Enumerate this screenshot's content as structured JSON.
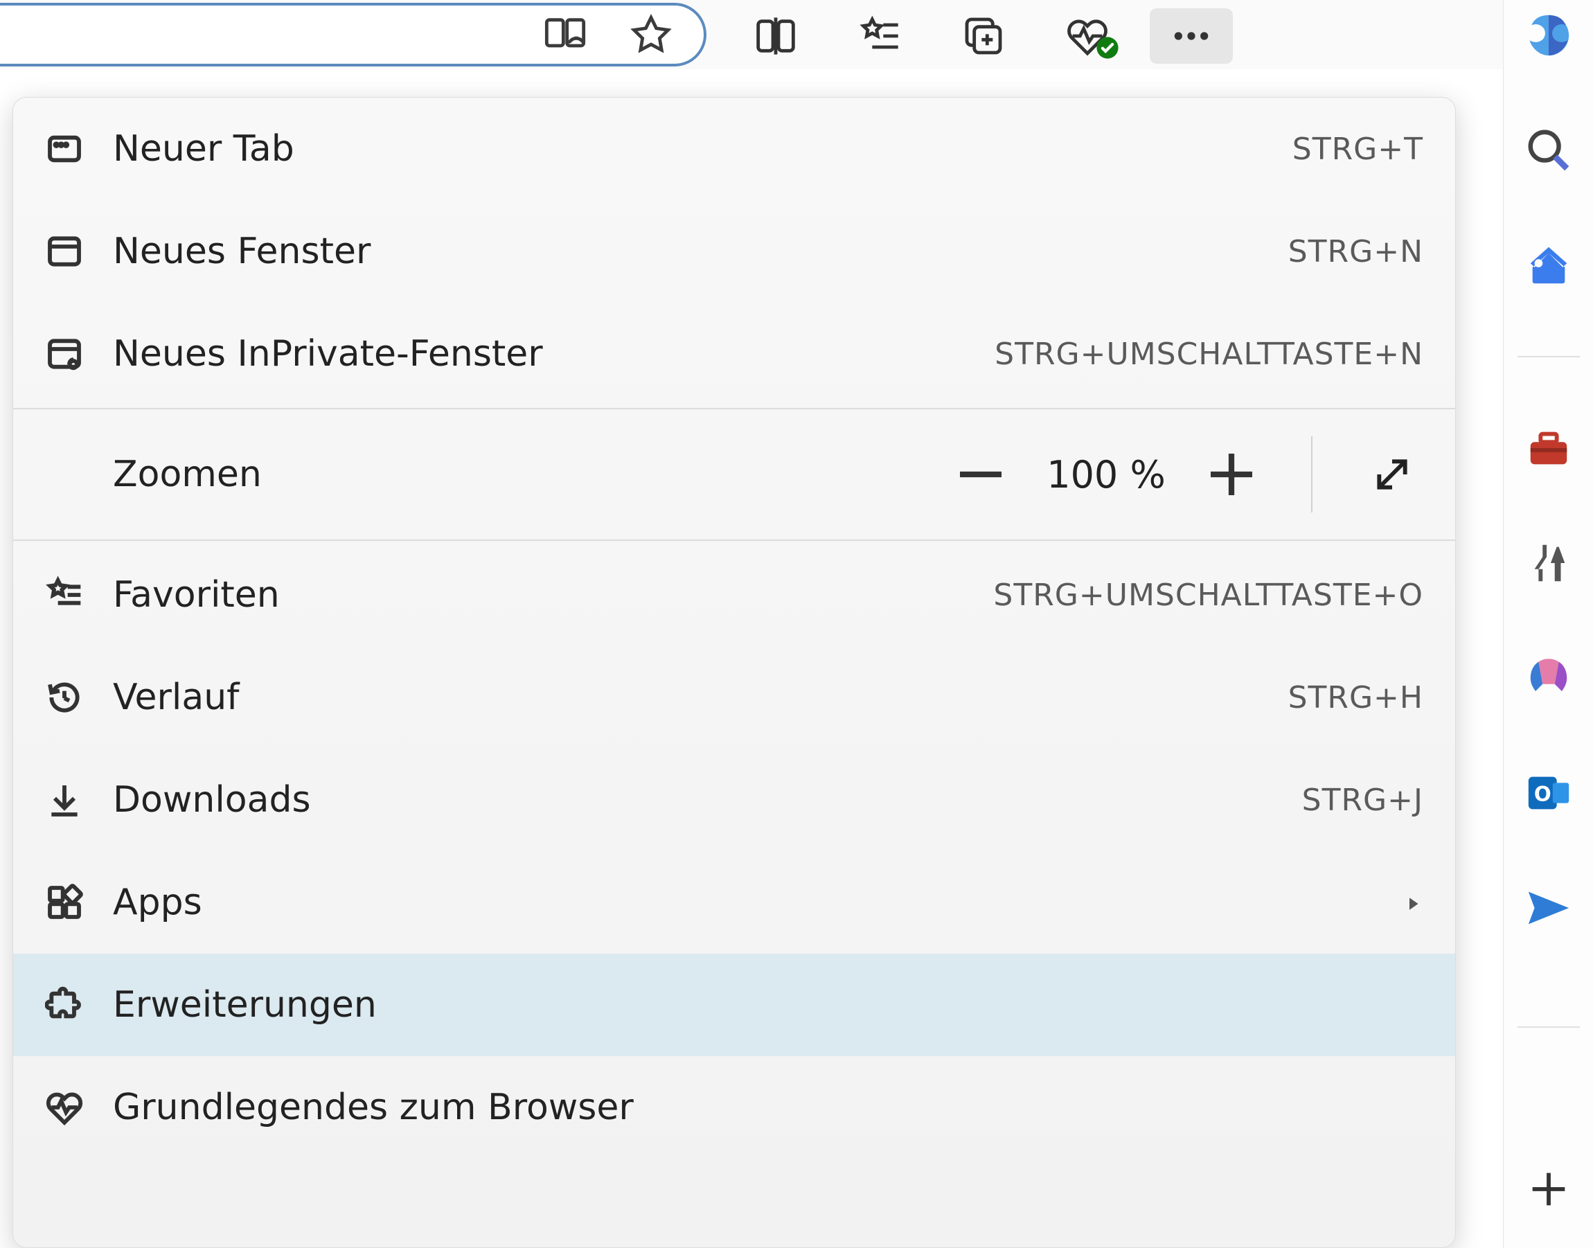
{
  "toolbar": {
    "address_value": "",
    "icons": {
      "reader": "reader-icon",
      "favorite": "star-icon",
      "split": "split-screen-icon",
      "favorites": "favorites-icon",
      "collections": "collections-icon",
      "browser_health": "browser-health-icon",
      "more": "more-icon",
      "copilot": "copilot-icon"
    }
  },
  "menu": {
    "items": [
      {
        "icon": "new-tab-icon",
        "label": "Neuer Tab",
        "shortcut": "STRG+T"
      },
      {
        "icon": "new-window-icon",
        "label": "Neues Fenster",
        "shortcut": "STRG+N"
      },
      {
        "icon": "inprivate-icon",
        "label": "Neues InPrivate-Fenster",
        "shortcut": "STRG+UMSCHALTTASTE+N"
      }
    ],
    "zoom": {
      "label": "Zoomen",
      "value": "100 %"
    },
    "items2": [
      {
        "icon": "favorites-icon",
        "label": "Favoriten",
        "shortcut": "STRG+UMSCHALTTASTE+O"
      },
      {
        "icon": "history-icon",
        "label": "Verlauf",
        "shortcut": "STRG+H"
      },
      {
        "icon": "downloads-icon",
        "label": "Downloads",
        "shortcut": "STRG+J"
      },
      {
        "icon": "apps-icon",
        "label": "Apps",
        "submenu": true
      },
      {
        "icon": "extensions-icon",
        "label": "Erweiterungen",
        "hover": true
      },
      {
        "icon": "browser-essentials-icon",
        "label": "Grundlegendes zum Browser"
      }
    ]
  },
  "sidebar": {
    "items": [
      {
        "name": "copilot"
      },
      {
        "name": "search"
      },
      {
        "name": "shopping"
      },
      {
        "name": "tools"
      },
      {
        "name": "games"
      },
      {
        "name": "office"
      },
      {
        "name": "outlook"
      },
      {
        "name": "send"
      }
    ],
    "add": "+"
  }
}
